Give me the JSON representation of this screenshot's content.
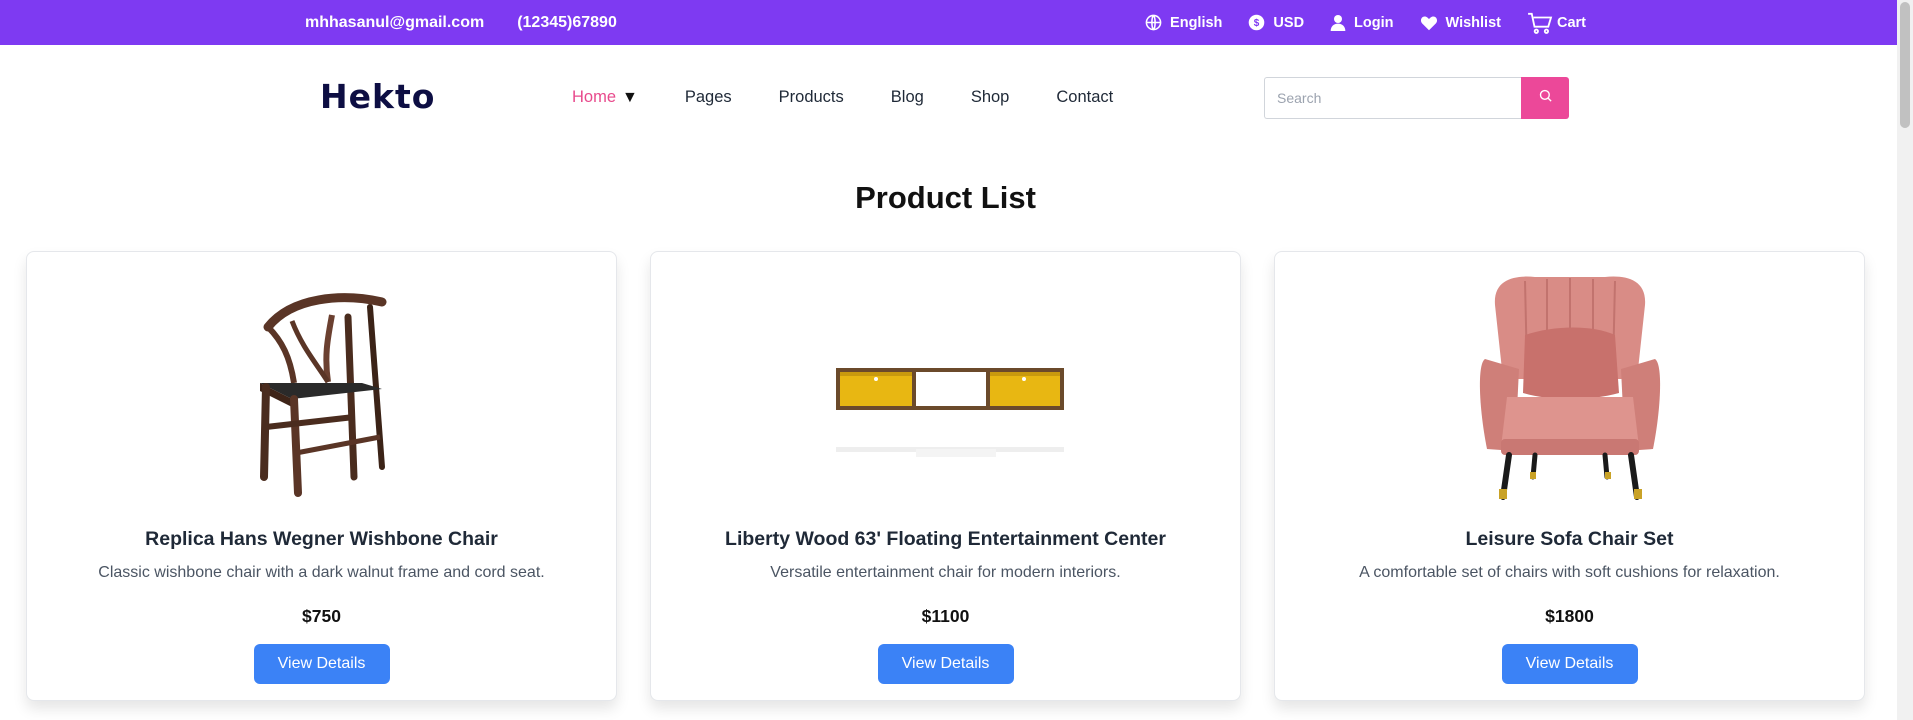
{
  "topbar": {
    "email": "mhhasanul@gmail.com",
    "phone": "(12345)67890",
    "language": "English",
    "currency": "USD",
    "login": "Login",
    "wishlist": "Wishlist",
    "cart": "Cart"
  },
  "nav": {
    "logo": "Hekto",
    "items": [
      "Home",
      "Pages",
      "Products",
      "Blog",
      "Shop",
      "Contact"
    ],
    "home_caret": "▼",
    "search_placeholder": "Search"
  },
  "main": {
    "title": "Product List",
    "products": [
      {
        "name": "Replica Hans Wegner Wishbone Chair",
        "description": "Classic wishbone chair with a dark walnut frame and cord seat.",
        "price": "$750",
        "button": "View Details",
        "image": "wishbone-chair"
      },
      {
        "name": "Liberty Wood 63' Floating Entertainment Center",
        "description": "Versatile entertainment chair for modern interiors.",
        "price": "$1100",
        "button": "View Details",
        "image": "floating-tv-console"
      },
      {
        "name": "Leisure Sofa Chair Set",
        "description": "A comfortable set of chairs with soft cushions for relaxation.",
        "price": "$1800",
        "button": "View Details",
        "image": "pink-armchair"
      }
    ]
  },
  "colors": {
    "topbar": "#7e3af2",
    "accent_pink": "#ec4899",
    "nav_active": "#e84a8c",
    "button_blue": "#3b82f6",
    "logo": "#0d0e43"
  },
  "icons": [
    "globe-icon",
    "dollar-icon",
    "user-icon",
    "heart-icon",
    "cart-icon",
    "search-icon"
  ]
}
